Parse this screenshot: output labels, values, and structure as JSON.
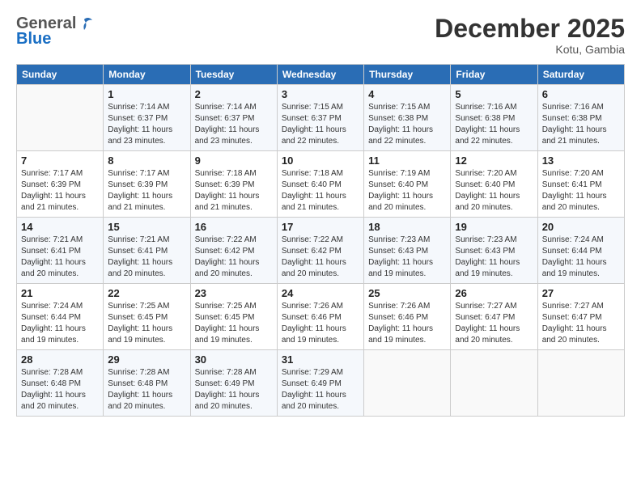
{
  "header": {
    "title": "December 2025",
    "location": "Kotu, Gambia"
  },
  "days": [
    "Sunday",
    "Monday",
    "Tuesday",
    "Wednesday",
    "Thursday",
    "Friday",
    "Saturday"
  ],
  "weeks": [
    [
      {
        "num": "",
        "sunrise": "",
        "sunset": "",
        "daylight": ""
      },
      {
        "num": "1",
        "sunrise": "Sunrise: 7:14 AM",
        "sunset": "Sunset: 6:37 PM",
        "daylight": "Daylight: 11 hours and 23 minutes."
      },
      {
        "num": "2",
        "sunrise": "Sunrise: 7:14 AM",
        "sunset": "Sunset: 6:37 PM",
        "daylight": "Daylight: 11 hours and 23 minutes."
      },
      {
        "num": "3",
        "sunrise": "Sunrise: 7:15 AM",
        "sunset": "Sunset: 6:37 PM",
        "daylight": "Daylight: 11 hours and 22 minutes."
      },
      {
        "num": "4",
        "sunrise": "Sunrise: 7:15 AM",
        "sunset": "Sunset: 6:38 PM",
        "daylight": "Daylight: 11 hours and 22 minutes."
      },
      {
        "num": "5",
        "sunrise": "Sunrise: 7:16 AM",
        "sunset": "Sunset: 6:38 PM",
        "daylight": "Daylight: 11 hours and 22 minutes."
      },
      {
        "num": "6",
        "sunrise": "Sunrise: 7:16 AM",
        "sunset": "Sunset: 6:38 PM",
        "daylight": "Daylight: 11 hours and 21 minutes."
      }
    ],
    [
      {
        "num": "7",
        "sunrise": "Sunrise: 7:17 AM",
        "sunset": "Sunset: 6:39 PM",
        "daylight": "Daylight: 11 hours and 21 minutes."
      },
      {
        "num": "8",
        "sunrise": "Sunrise: 7:17 AM",
        "sunset": "Sunset: 6:39 PM",
        "daylight": "Daylight: 11 hours and 21 minutes."
      },
      {
        "num": "9",
        "sunrise": "Sunrise: 7:18 AM",
        "sunset": "Sunset: 6:39 PM",
        "daylight": "Daylight: 11 hours and 21 minutes."
      },
      {
        "num": "10",
        "sunrise": "Sunrise: 7:18 AM",
        "sunset": "Sunset: 6:40 PM",
        "daylight": "Daylight: 11 hours and 21 minutes."
      },
      {
        "num": "11",
        "sunrise": "Sunrise: 7:19 AM",
        "sunset": "Sunset: 6:40 PM",
        "daylight": "Daylight: 11 hours and 20 minutes."
      },
      {
        "num": "12",
        "sunrise": "Sunrise: 7:20 AM",
        "sunset": "Sunset: 6:40 PM",
        "daylight": "Daylight: 11 hours and 20 minutes."
      },
      {
        "num": "13",
        "sunrise": "Sunrise: 7:20 AM",
        "sunset": "Sunset: 6:41 PM",
        "daylight": "Daylight: 11 hours and 20 minutes."
      }
    ],
    [
      {
        "num": "14",
        "sunrise": "Sunrise: 7:21 AM",
        "sunset": "Sunset: 6:41 PM",
        "daylight": "Daylight: 11 hours and 20 minutes."
      },
      {
        "num": "15",
        "sunrise": "Sunrise: 7:21 AM",
        "sunset": "Sunset: 6:41 PM",
        "daylight": "Daylight: 11 hours and 20 minutes."
      },
      {
        "num": "16",
        "sunrise": "Sunrise: 7:22 AM",
        "sunset": "Sunset: 6:42 PM",
        "daylight": "Daylight: 11 hours and 20 minutes."
      },
      {
        "num": "17",
        "sunrise": "Sunrise: 7:22 AM",
        "sunset": "Sunset: 6:42 PM",
        "daylight": "Daylight: 11 hours and 20 minutes."
      },
      {
        "num": "18",
        "sunrise": "Sunrise: 7:23 AM",
        "sunset": "Sunset: 6:43 PM",
        "daylight": "Daylight: 11 hours and 19 minutes."
      },
      {
        "num": "19",
        "sunrise": "Sunrise: 7:23 AM",
        "sunset": "Sunset: 6:43 PM",
        "daylight": "Daylight: 11 hours and 19 minutes."
      },
      {
        "num": "20",
        "sunrise": "Sunrise: 7:24 AM",
        "sunset": "Sunset: 6:44 PM",
        "daylight": "Daylight: 11 hours and 19 minutes."
      }
    ],
    [
      {
        "num": "21",
        "sunrise": "Sunrise: 7:24 AM",
        "sunset": "Sunset: 6:44 PM",
        "daylight": "Daylight: 11 hours and 19 minutes."
      },
      {
        "num": "22",
        "sunrise": "Sunrise: 7:25 AM",
        "sunset": "Sunset: 6:45 PM",
        "daylight": "Daylight: 11 hours and 19 minutes."
      },
      {
        "num": "23",
        "sunrise": "Sunrise: 7:25 AM",
        "sunset": "Sunset: 6:45 PM",
        "daylight": "Daylight: 11 hours and 19 minutes."
      },
      {
        "num": "24",
        "sunrise": "Sunrise: 7:26 AM",
        "sunset": "Sunset: 6:46 PM",
        "daylight": "Daylight: 11 hours and 19 minutes."
      },
      {
        "num": "25",
        "sunrise": "Sunrise: 7:26 AM",
        "sunset": "Sunset: 6:46 PM",
        "daylight": "Daylight: 11 hours and 19 minutes."
      },
      {
        "num": "26",
        "sunrise": "Sunrise: 7:27 AM",
        "sunset": "Sunset: 6:47 PM",
        "daylight": "Daylight: 11 hours and 20 minutes."
      },
      {
        "num": "27",
        "sunrise": "Sunrise: 7:27 AM",
        "sunset": "Sunset: 6:47 PM",
        "daylight": "Daylight: 11 hours and 20 minutes."
      }
    ],
    [
      {
        "num": "28",
        "sunrise": "Sunrise: 7:28 AM",
        "sunset": "Sunset: 6:48 PM",
        "daylight": "Daylight: 11 hours and 20 minutes."
      },
      {
        "num": "29",
        "sunrise": "Sunrise: 7:28 AM",
        "sunset": "Sunset: 6:48 PM",
        "daylight": "Daylight: 11 hours and 20 minutes."
      },
      {
        "num": "30",
        "sunrise": "Sunrise: 7:28 AM",
        "sunset": "Sunset: 6:49 PM",
        "daylight": "Daylight: 11 hours and 20 minutes."
      },
      {
        "num": "31",
        "sunrise": "Sunrise: 7:29 AM",
        "sunset": "Sunset: 6:49 PM",
        "daylight": "Daylight: 11 hours and 20 minutes."
      },
      {
        "num": "",
        "sunrise": "",
        "sunset": "",
        "daylight": ""
      },
      {
        "num": "",
        "sunrise": "",
        "sunset": "",
        "daylight": ""
      },
      {
        "num": "",
        "sunrise": "",
        "sunset": "",
        "daylight": ""
      }
    ]
  ]
}
